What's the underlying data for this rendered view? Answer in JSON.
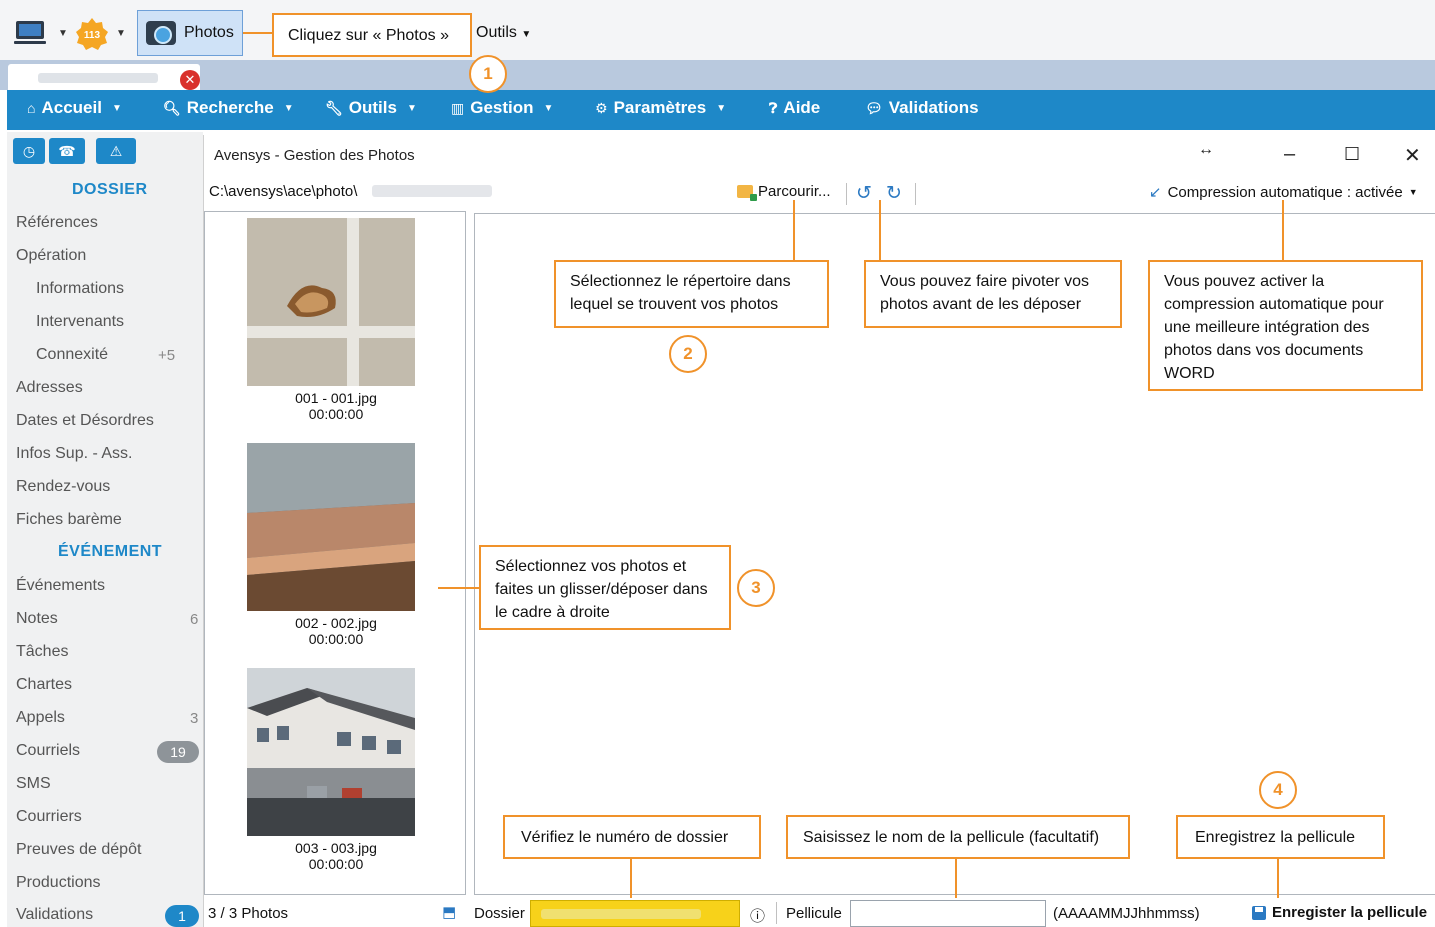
{
  "toolbar": {
    "badge_count": "113",
    "photos_label": "Photos",
    "outils_label": "Outils"
  },
  "navbar": {
    "items": [
      {
        "label": "Accueil",
        "icon": "home-icon"
      },
      {
        "label": "Recherche",
        "icon": "search-icon"
      },
      {
        "label": "Outils",
        "icon": "wrench-icon"
      },
      {
        "label": "Gestion",
        "icon": "chart-icon"
      },
      {
        "label": "Paramètres",
        "icon": "gears-icon"
      },
      {
        "label": "Aide",
        "icon": "help-icon"
      },
      {
        "label": "Validations",
        "icon": "chat-icon"
      }
    ]
  },
  "sidebar": {
    "heading_dossier": "DOSSIER",
    "heading_evenement": "ÉVÉNEMENT",
    "items": [
      {
        "label": "Références"
      },
      {
        "label": "Opération"
      },
      {
        "label": "Informations"
      },
      {
        "label": "Intervenants"
      },
      {
        "label": "Connexité",
        "count": "+5"
      },
      {
        "label": "Adresses"
      },
      {
        "label": "Dates et Désordres"
      },
      {
        "label": "Infos Sup. - Ass."
      },
      {
        "label": "Rendez-vous"
      },
      {
        "label": "Fiches barème"
      },
      {
        "label": "Événements"
      },
      {
        "label": "Notes",
        "count": "6"
      },
      {
        "label": "Tâches"
      },
      {
        "label": "Chartes"
      },
      {
        "label": "Appels",
        "count": "3"
      },
      {
        "label": "Courriels",
        "count": "19"
      },
      {
        "label": "SMS"
      },
      {
        "label": "Courriers"
      },
      {
        "label": "Preuves de dépôt"
      },
      {
        "label": "Productions"
      },
      {
        "label": "Validations",
        "count": "1"
      }
    ]
  },
  "window": {
    "title": "Avensys - Gestion des Photos",
    "path_prefix": "C:\\avensys\\ace\\photo\\",
    "browse_label": "Parcourir...",
    "compression_label": "Compression automatique : activée"
  },
  "thumbnails": [
    {
      "name": "001 - 001.jpg",
      "time": "00:00:00"
    },
    {
      "name": "002 - 002.jpg",
      "time": "00:00:00"
    },
    {
      "name": "003 - 003.jpg",
      "time": "00:00:00"
    }
  ],
  "status": {
    "count": "3 /  3 Photos",
    "dossier_label": "Dossier",
    "pellicule_label": "Pellicule",
    "pellicule_value": "",
    "format_hint": "(AAAAMMJJhhmmss)",
    "save_label": "Enregister la pellicule"
  },
  "annotations": {
    "step1": "Cliquez sur « Photos »",
    "step2": "Sélectionnez le répertoire dans lequel se trouvent vos photos",
    "rotate": "Vous pouvez faire pivoter vos photos avant de les déposer",
    "compress": "Vous pouvez activer la compression automatique pour une meilleure intégration des photos dans vos documents WORD",
    "step3": "Sélectionnez vos photos et faites un glisser/déposer dans le cadre à droite",
    "dossier": "Vérifiez le numéro de dossier",
    "pellicule": "Saisissez le nom de la pellicule (facultatif)",
    "save": "Enregistrez la pellicule",
    "numbers": [
      "1",
      "2",
      "3",
      "4"
    ]
  },
  "colors": {
    "accent": "#1e88c8",
    "annotation": "#f0922a",
    "dossier_field": "#f7d21a",
    "close": "#d9312b"
  }
}
